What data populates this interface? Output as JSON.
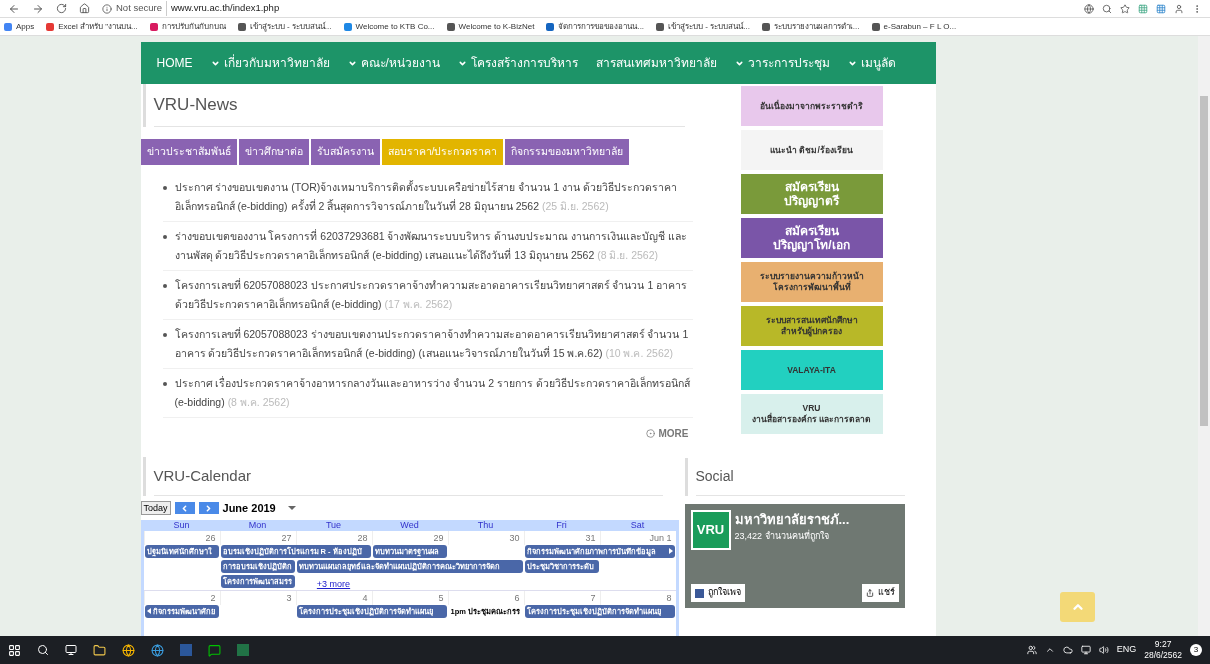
{
  "browser": {
    "security": "Not secure",
    "url": "www.vru.ac.th/index1.php"
  },
  "bookmarks": [
    {
      "label": "Apps",
      "color": "#4285f4"
    },
    {
      "label": "Excel สำหรับ \"งานบน...",
      "color": "#e53935"
    },
    {
      "label": "การปรับกันกับกบณ",
      "color": "#d81b60"
    },
    {
      "label": "เข้าสู่ระบบ - ระบบสนน์...",
      "color": "#555555"
    },
    {
      "label": "Welcome to KTB Co...",
      "color": "#1e88e5"
    },
    {
      "label": "Welcome to K-BizNet",
      "color": "#555555"
    },
    {
      "label": "จัดการการขอของอานน...",
      "color": "#1565c0"
    },
    {
      "label": "เข้าสู่ระบบ - ระบบสนน์...",
      "color": "#555555"
    },
    {
      "label": "ระบบรายงานผลการดำเ...",
      "color": "#555555"
    },
    {
      "label": "e-Sarabun – F L O...",
      "color": "#555555"
    }
  ],
  "nav": [
    {
      "label": "HOME",
      "dropdown": false
    },
    {
      "label": "เกี่ยวกับมหาวิทยาลัย",
      "dropdown": true
    },
    {
      "label": "คณะ/หน่วยงาน",
      "dropdown": true
    },
    {
      "label": "โครงสร้างการบริหาร",
      "dropdown": true
    },
    {
      "label": "สารสนเทศมหาวิทยาลัย",
      "dropdown": false
    },
    {
      "label": "วาระการประชุม",
      "dropdown": true
    },
    {
      "label": "เมนูลัด",
      "dropdown": true
    }
  ],
  "news": {
    "title": "VRU-News",
    "tabs": [
      {
        "label": "ข่าวประชาสัมพันธ์",
        "selected": false
      },
      {
        "label": "ข่าวศึกษาต่อ",
        "selected": false
      },
      {
        "label": "รับสมัครงาน",
        "selected": false
      },
      {
        "label": "สอบราคา/ประกวดราคา",
        "selected": true
      },
      {
        "label": "กิจกรรมของมหาวิทยาลัย",
        "selected": false
      }
    ],
    "items": [
      {
        "text": "ประกาศ ร่างขอบเขตงาน (TOR)จ้างเหมาบริการติดตั้งระบบเครือข่ายไร้สาย จำนวน 1 งาน ด้วยวิธีประกวดราคาอิเล็กทรอนิกส์ (e-bidding) ครั้งที่ 2 สิ้นสุดการวิจารณ์ภายในวันที่ 28 มิถุนายน 2562",
        "date": "(25 มิ.ย. 2562)"
      },
      {
        "text": "ร่างขอบเขตของงาน โครงการที่ 62037293681 จ้างพัฒนาระบบบริหาร ด้านงบประมาณ งานการเงินและบัญชี และงานพัสดุ ด้วยวิธีประกวดราคาอิเล็กทรอนิกส์ (e-bidding) เสนอแนะได้ถึงวันที่ 13 มิถุนายน 2562",
        "date": "(8 มิ.ย. 2562)"
      },
      {
        "text": "โครงการเลขที่ 62057088023 ประกาศประกวดราคาจ้างทำความสะอาดอาคารเรียนวิทยาศาสตร์ จำนวน 1 อาคาร ด้วยวิธีประกวดราคาอิเล็กทรอนิกส์ (e-bidding)",
        "date": "(17 พ.ค. 2562)"
      },
      {
        "text": "โครงการเลขที่ 62057088023 ร่างขอบเขตงานประกวดราคาจ้างทำความสะอาดอาคารเรียนวิทยาศาสตร์ จำนวน 1 อาคาร ด้วยวิธีประกวดราคาอิเล็กทรอนิกส์ (e-bidding) (เสนอแนะวิจารณ์ภายในวันที่ 15 พ.ค.62)",
        "date": "(10 พ.ค. 2562)"
      },
      {
        "text": "ประกาศ เรื่องประกวดราคาจ้างอาหารกลางวันและอาหารว่าง จำนวน 2 รายการ ด้วยวิธีประกวดราคาอิเล็กทรอนิกส์ (e-bidding)",
        "date": "(8 พ.ค. 2562)"
      }
    ],
    "more": "MORE"
  },
  "banners": [
    {
      "lines": [
        "อันเนื่องมาจากพระราชดำริ"
      ],
      "color": "#e8c8ec"
    },
    {
      "lines": [
        "แนะนำ ติชม/ร้องเรียน"
      ],
      "color": "#f4f4f4"
    },
    {
      "lines": [
        "สมัครเรียน",
        "ปริญญาตรี"
      ],
      "color": "#7a9a3a"
    },
    {
      "lines": [
        "สมัครเรียน",
        "ปริญญาโท/เอก"
      ],
      "color": "#7a55a8"
    },
    {
      "lines": [
        "ระบบรายงานความก้าวหน้า",
        "โครงการพัฒนาพื้นที่"
      ],
      "color": "#e8b070"
    },
    {
      "lines": [
        "ระบบสารสนเทศนักศึกษา",
        "สำหรับผู้ปกครอง"
      ],
      "color": "#b8b828"
    },
    {
      "lines": [
        "VALAYA-ITA"
      ],
      "color": "#22d0c0"
    },
    {
      "lines": [
        "VRU",
        "งานสื่อสารองค์กร และการตลาด"
      ],
      "color": "#d8f0ec"
    }
  ],
  "calendar": {
    "title": "VRU-Calendar",
    "today": "Today",
    "month": "June 2019",
    "weekdays": [
      "Sun",
      "Mon",
      "Tue",
      "Wed",
      "Thu",
      "Fri",
      "Sat"
    ],
    "weeks": [
      {
        "days": [
          "26",
          "27",
          "28",
          "29",
          "30",
          "31",
          "Jun 1"
        ],
        "lanes": [
          [
            {
              "kind": "event",
              "title": "ปฐมนิเทศนักศึกษาใ"
            },
            {
              "kind": "event",
              "title": "อบรมเชิงปฏิบัติการโปรแกรม R - ห้องปฏิบั"
            },
            {
              "kind": "cont"
            },
            {
              "kind": "event",
              "title": "ทบทวนมาตรฐานผล"
            },
            {
              "kind": "empty"
            },
            {
              "kind": "event",
              "title": "กิจกรรมพัฒนาศักยภาพการบันทึกข้อมูล",
              "cut_right": true
            },
            {
              "kind": "cont"
            }
          ],
          [
            {
              "kind": "empty"
            },
            {
              "kind": "event",
              "title": "การอบรมเชิงปฏิบัติก"
            },
            {
              "kind": "event",
              "title": "ทบทวนแผนกลยุทธ์และจัดทำแผนปฏิบัติการคณะวิทยาการจัดก"
            },
            {
              "kind": "cont"
            },
            {
              "kind": "cont"
            },
            {
              "kind": "event",
              "title": "ประชุมวิชาการระดับ"
            },
            {
              "kind": "empty"
            }
          ],
          [
            {
              "kind": "empty"
            },
            {
              "kind": "event",
              "title": "โครงการพัฒนาสมรร"
            },
            {
              "kind": "more",
              "title": "+3 more"
            },
            {
              "kind": "empty"
            },
            {
              "kind": "empty"
            },
            {
              "kind": "empty"
            },
            {
              "kind": "empty"
            }
          ]
        ]
      },
      {
        "days": [
          "2",
          "3",
          "4",
          "5",
          "6",
          "7",
          "8"
        ],
        "lanes": [
          [
            {
              "kind": "event",
              "title": "กิจกรรมพัฒนาศักย",
              "cut_left": true
            },
            {
              "kind": "empty"
            },
            {
              "kind": "event",
              "title": "โครงการประชุมเชิงปฏิบัติการจัดทำแผนยุ"
            },
            {
              "kind": "cont"
            },
            {
              "kind": "timed",
              "title": "1pm ประชุมคณะกรร"
            },
            {
              "kind": "event",
              "title": "โครงการประชุมเชิงปฏิบัติการจัดทำแผนยุ"
            },
            {
              "kind": "cont"
            }
          ]
        ]
      }
    ]
  },
  "social": {
    "title": "Social",
    "logo": "VRU",
    "page_name": "มหาวิทยาลัยราชภั...",
    "likes": "23,422 จำนวนคนที่ถูกใจ",
    "like_button": "ถูกใจเพจ",
    "share_button": "แชร์"
  },
  "taskbar": {
    "language": "ENG",
    "time": "9:27",
    "date": "28/6/2562",
    "notifications": "3"
  }
}
